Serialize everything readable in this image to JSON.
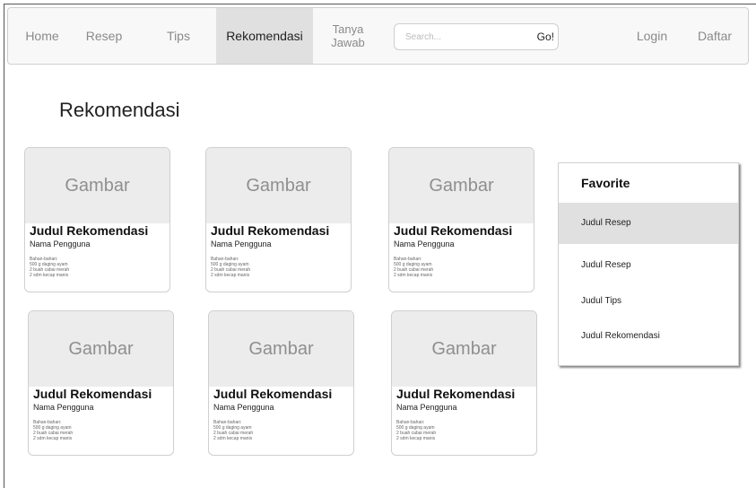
{
  "nav": {
    "items": [
      {
        "label": "Home",
        "active": false
      },
      {
        "label": "Resep",
        "active": false
      },
      {
        "label": "Tips",
        "active": false
      },
      {
        "label": "Rekomendasi",
        "active": true
      },
      {
        "label_line1": "Tanya",
        "label_line2": "Jawab",
        "active": false
      }
    ],
    "search_placeholder": "Search...",
    "go_label": "Go!",
    "login_label": "Login",
    "register_label": "Daftar"
  },
  "page": {
    "title": "Rekomendasi"
  },
  "cards": [
    {
      "image_label": "Gambar",
      "title": "Judul Rekomendasi",
      "user": "Nama Pengguna",
      "ingredients": [
        "Bahan-bahan:",
        "500 g daging ayam",
        "2 buah cabai merah",
        "2 sdm kecap manis"
      ]
    },
    {
      "image_label": "Gambar",
      "title": "Judul Rekomendasi",
      "user": "Nama Pengguna",
      "ingredients": [
        "Bahan-bahan:",
        "500 g daging ayam",
        "2 buah cabai merah",
        "2 sdm kecap manis"
      ]
    },
    {
      "image_label": "Gambar",
      "title": "Judul Rekomendasi",
      "user": "Nama Pengguna",
      "ingredients": [
        "Bahan-bahan:",
        "500 g daging ayam",
        "2 buah cabai merah",
        "2 sdm kecap manis"
      ]
    },
    {
      "image_label": "Gambar",
      "title": "Judul Rekomendasi",
      "user": "Nama Pengguna",
      "ingredients": [
        "Bahan-bahan:",
        "500 g daging ayam",
        "2 buah cabai merah",
        "2 sdm kecap manis"
      ]
    },
    {
      "image_label": "Gambar",
      "title": "Judul Rekomendasi",
      "user": "Nama Pengguna",
      "ingredients": [
        "Bahan-bahan:",
        "500 g daging ayam",
        "2 buah cabai merah",
        "2 sdm kecap manis"
      ]
    },
    {
      "image_label": "Gambar",
      "title": "Judul Rekomendasi",
      "user": "Nama Pengguna",
      "ingredients": [
        "Bahan-bahan:",
        "500 g daging ayam",
        "2 buah cabai merah",
        "2 sdm kecap manis"
      ]
    }
  ],
  "favorite": {
    "title": "Favorite",
    "items": [
      {
        "label": "Judul Resep",
        "active": true
      },
      {
        "label": "Judul Resep",
        "active": false
      },
      {
        "label": "Judul Tips",
        "active": false
      },
      {
        "label": "Judul Rekomendasi",
        "active": false
      }
    ]
  },
  "colors": {
    "active_nav_bg": "#e0e0e0",
    "navbar_bg": "#f8f8f8",
    "image_placeholder_bg": "#ececec",
    "inactive_nav_text": "#8a8a8a"
  }
}
